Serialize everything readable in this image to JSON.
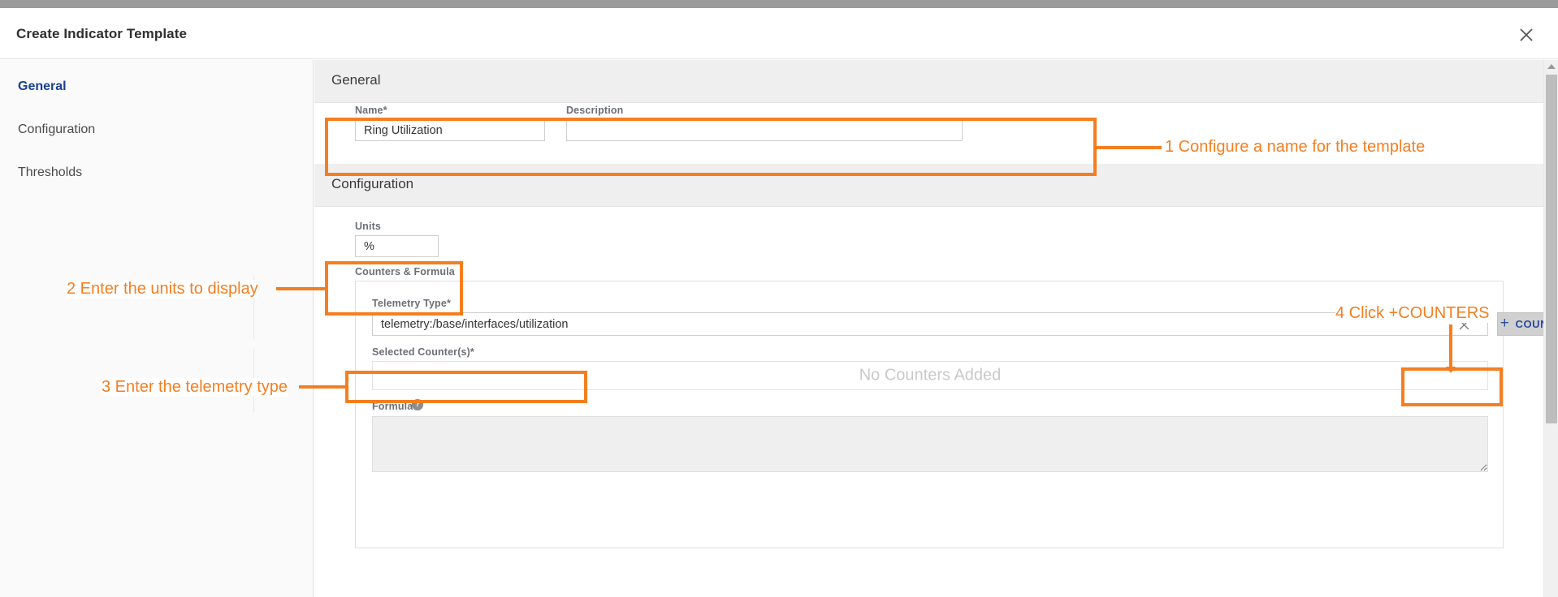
{
  "window": {
    "title": "Create Indicator Template",
    "close_icon": "close-icon"
  },
  "sidebar": {
    "items": [
      {
        "label": "General",
        "active": true
      },
      {
        "label": "Configuration",
        "active": false
      },
      {
        "label": "Thresholds",
        "active": false
      }
    ]
  },
  "sections": {
    "general": {
      "header": "General",
      "name": {
        "label": "Name*",
        "value": "Ring Utilization",
        "placeholder": ""
      },
      "description": {
        "label": "Description",
        "value": "",
        "placeholder": ""
      }
    },
    "configuration": {
      "header": "Configuration",
      "units": {
        "label": "Units",
        "value": "%",
        "placeholder": ""
      },
      "counters_formula": {
        "group_label": "Counters & Formula",
        "telemetry_type": {
          "label": "Telemetry Type*",
          "value": "telemetry:/base/interfaces/utilization",
          "placeholder": "",
          "clear_icon": "clear-x-icon"
        },
        "counters_button": {
          "label": "COUNTERS",
          "plus": "+"
        },
        "selected_counters": {
          "label": "Selected Counter(s)*",
          "empty_text": "No Counters Added"
        },
        "formula": {
          "label": "Formula",
          "help_icon": "help-icon",
          "help_glyph": "?",
          "value": ""
        }
      }
    }
  },
  "annotations": [
    {
      "id": 1,
      "text": "1 Configure a name for the template"
    },
    {
      "id": 2,
      "text": "2 Enter the units to display"
    },
    {
      "id": 3,
      "text": "3 Enter the telemetry type"
    },
    {
      "id": 4,
      "text": "4 Click +COUNTERS"
    }
  ],
  "colors": {
    "annotation": "#F57E20",
    "active_nav": "#1a3f8f",
    "button_text": "#2a4b9b"
  }
}
